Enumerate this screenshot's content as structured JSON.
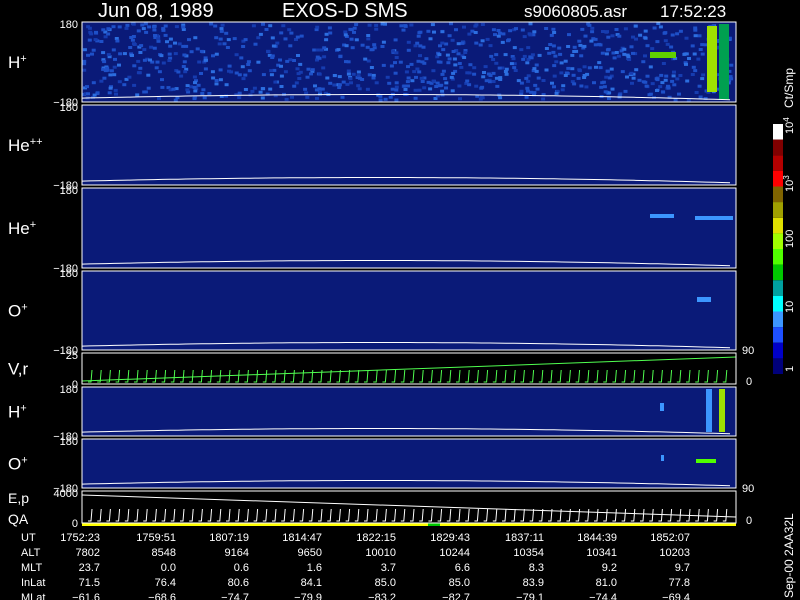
{
  "header": {
    "date": "Jun 08, 1989",
    "mission": "EXOS-D SMS",
    "file": "s9060805.asr",
    "time": "17:52:23"
  },
  "colorbar": {
    "unit": "Ct/Smp",
    "tick_labels": [
      "1",
      "10",
      "100",
      "10",
      "10"
    ],
    "exponents": [
      "",
      "",
      "",
      "3",
      "4"
    ],
    "colors": [
      "#00007a",
      "#0000c8",
      "#1e50ff",
      "#3c96ff",
      "#00ffff",
      "#00a0a0",
      "#00c800",
      "#50ff00",
      "#a0ff00",
      "#e0e000",
      "#a0a000",
      "#806400",
      "#ff0000",
      "#b40000",
      "#800000",
      "#ffffff"
    ]
  },
  "side_label": "Sep-00  2AA32L",
  "colors": {
    "background": "#000000",
    "panel_bg": "#0a1a78",
    "foreground": "#ffffff",
    "trace": "#50ff50"
  },
  "chart_data": {
    "type": "heatmap",
    "panels": [
      {
        "label": "H",
        "sup": "+",
        "y_top": "180",
        "y_bottom": "−180"
      },
      {
        "label": "He",
        "sup": "++",
        "y_top": "180",
        "y_bottom": "−180"
      },
      {
        "label": "He",
        "sup": "+",
        "y_top": "180",
        "y_bottom": "−180"
      },
      {
        "label": "O",
        "sup": "+",
        "y_top": "180",
        "y_bottom": "−180"
      },
      {
        "label": "V,r",
        "sup": "",
        "y_top": "25",
        "y_bottom": "0",
        "right_top": "90",
        "right_bottom": "0"
      },
      {
        "label": "H",
        "sup": "+",
        "y_top": "180",
        "y_bottom": "−180"
      },
      {
        "label": "O",
        "sup": "+",
        "y_top": "180",
        "y_bottom": "−180"
      },
      {
        "label": "E,p",
        "label2": "QA",
        "sup": "",
        "y_top": "4000",
        "y_bottom": "0",
        "right_top": "90",
        "right_bottom": "0"
      }
    ],
    "table": {
      "rows": [
        {
          "name": "UT",
          "values": [
            "1752:23",
            "1759:51",
            "1807:19",
            "1814:47",
            "1822:15",
            "1829:43",
            "1837:11",
            "1844:39",
            "1852:07"
          ]
        },
        {
          "name": "ALT",
          "values": [
            "7802",
            "8548",
            "9164",
            "9650",
            "10010",
            "10244",
            "10354",
            "10341",
            "10203"
          ]
        },
        {
          "name": "MLT",
          "values": [
            "23.7",
            "0.0",
            "0.6",
            "1.6",
            "3.7",
            "6.6",
            "8.3",
            "9.2",
            "9.7"
          ]
        },
        {
          "name": "InLat",
          "values": [
            "71.5",
            "76.4",
            "80.6",
            "84.1",
            "85.0",
            "85.0",
            "83.9",
            "81.0",
            "77.8"
          ]
        },
        {
          "name": "MLat",
          "values": [
            "−61.6",
            "−68.6",
            "−74.7",
            "−79.9",
            "−83.2",
            "−82.7",
            "−79.1",
            "−74.4",
            "−69.4"
          ]
        }
      ]
    }
  }
}
